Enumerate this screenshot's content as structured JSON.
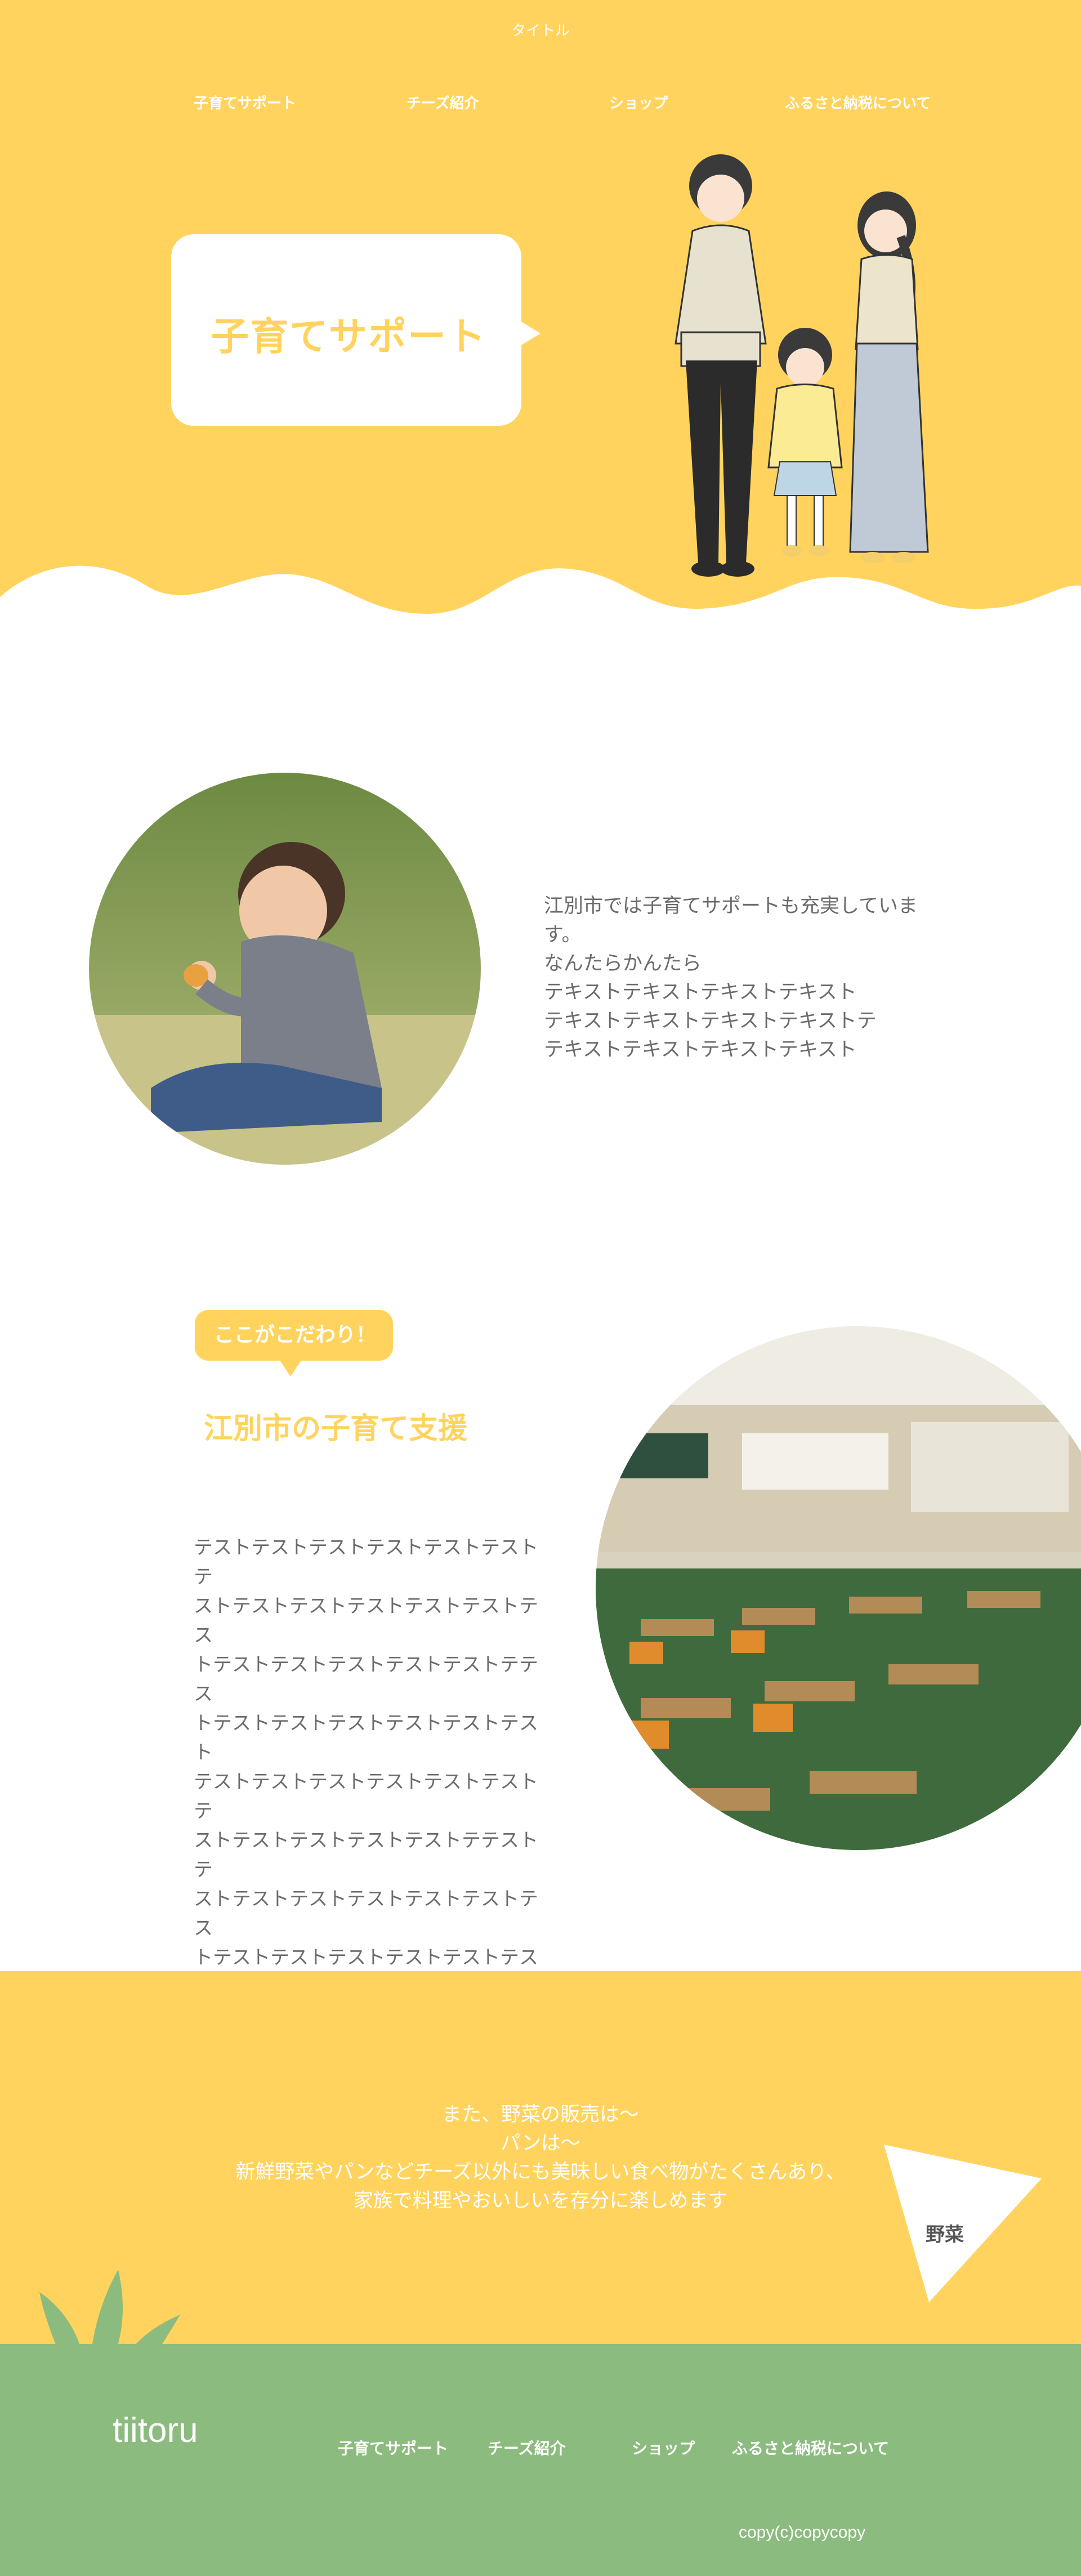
{
  "header": {
    "title": "タイトル",
    "nav": [
      "子育てサポート",
      "チーズ紹介",
      "ショップ",
      "ふるさと納税について"
    ]
  },
  "hero": {
    "heading": "子育てサポート"
  },
  "intro": {
    "lines": [
      "江別市では子育てサポートも充実しています。",
      "なんたらかんたら",
      "テキストテキストテキストテキスト",
      "テキストテキストテキストテキストテ",
      "テキストテキストテキストテキスト"
    ]
  },
  "section2": {
    "tag": "ここがこだわり！",
    "heading": "江別市の子育て支援",
    "body_lines": [
      "テストテストテストテストテストテストテ",
      "ストテストテストテストテストテストテス",
      "トテストテストテストテストテストテテス",
      "トテストテストテストテストテストテスト",
      "テストテストテストテストテストテストテ",
      "ストテストテストテストテストテテストテ",
      "ストテストテストテストテストテストテス",
      "トテストテストテストテストテストテスト"
    ]
  },
  "band": {
    "lines": [
      "また、野菜の販売は～",
      "パンは～",
      "新鮮野菜やパンなどチーズ以外にも美味しい食べ物がたくさんあり、",
      "家族で料理やおいしいを存分に楽しめます"
    ],
    "triangle_label": "野菜"
  },
  "footer": {
    "logo": "tiitoru",
    "nav": [
      "子育てサポート",
      "チーズ紹介",
      "ショップ",
      "ふるさと納税について"
    ],
    "copyright": "copy(c)copycopy"
  },
  "colors": {
    "accent_yellow": "#FFD35E",
    "footer_green": "#8CBB7F",
    "text_gray": "#6b6b6b"
  }
}
